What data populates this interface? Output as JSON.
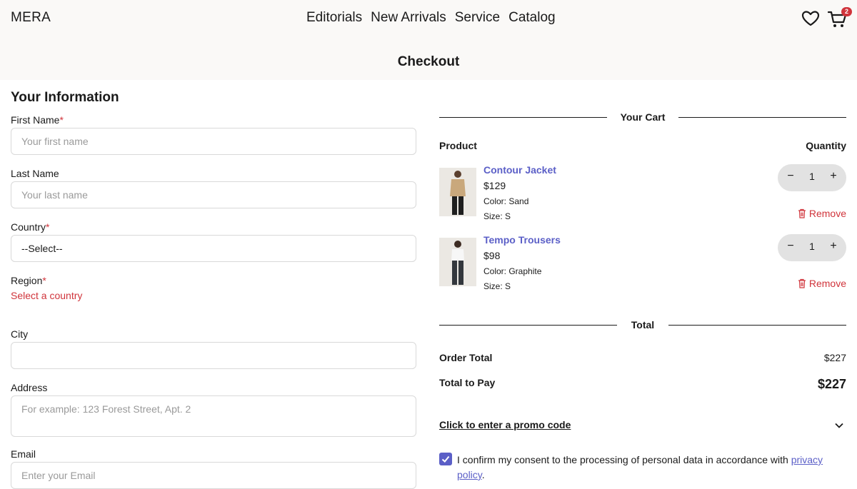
{
  "header": {
    "logo": "MERA",
    "nav": [
      "Editorials",
      "New Arrivals",
      "Service",
      "Catalog"
    ],
    "cart_count": "2"
  },
  "page_title": "Checkout",
  "form": {
    "section_title": "Your Information",
    "first_name": {
      "label": "First Name",
      "required": "*",
      "placeholder": "Your first name"
    },
    "last_name": {
      "label": "Last Name",
      "placeholder": "Your last name"
    },
    "country": {
      "label": "Country",
      "required": "*",
      "value": "--Select--"
    },
    "region": {
      "label": "Region",
      "required": "*",
      "hint": "Select a country"
    },
    "city": {
      "label": "City",
      "placeholder": ""
    },
    "address": {
      "label": "Address",
      "placeholder": "For example: 123 Forest Street, Apt. 2"
    },
    "email": {
      "label": "Email",
      "placeholder": "Enter your Email"
    }
  },
  "cart": {
    "title": "Your Cart",
    "col_product": "Product",
    "col_quantity": "Quantity",
    "items": [
      {
        "name": "Contour Jacket",
        "price": "$129",
        "color": "Color: Sand",
        "size": "Size: S",
        "qty": "1",
        "remove": "Remove",
        "minus": "−",
        "plus": "+"
      },
      {
        "name": "Tempo Trousers",
        "price": "$98",
        "color": "Color: Graphite",
        "size": "Size: S",
        "qty": "1",
        "remove": "Remove",
        "minus": "−",
        "plus": "+"
      }
    ]
  },
  "totals": {
    "title": "Total",
    "order_total_label": "Order Total",
    "order_total_value": "$227",
    "to_pay_label": "Total to Pay",
    "to_pay_value": "$227"
  },
  "promo_label": "Click to enter a promo code",
  "consent": {
    "text": "I confirm my consent to the processing of personal data in accordance with ",
    "link": "privacy policy",
    "end": ".",
    "checked": true
  },
  "colors": {
    "accent": "#5b5fc7",
    "error": "#d0343b",
    "header_bg": "#faf9f7"
  }
}
